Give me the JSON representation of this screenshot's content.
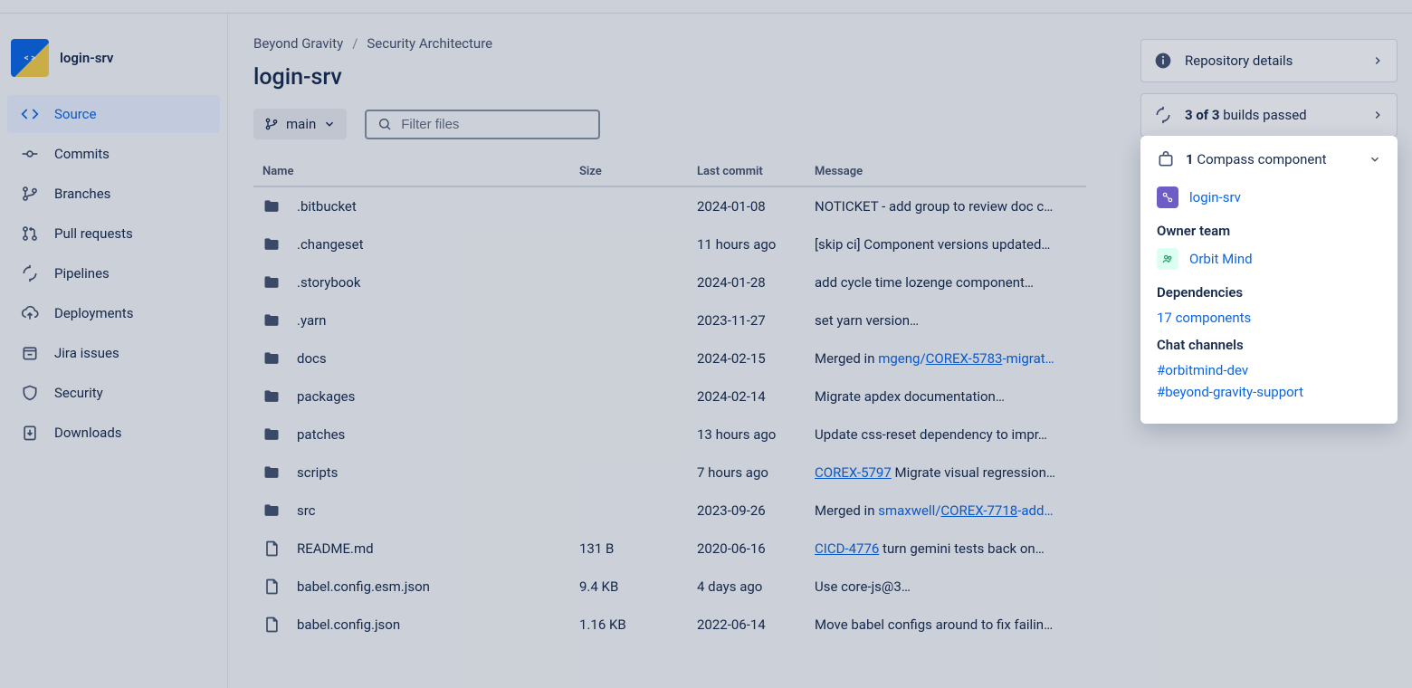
{
  "repo": {
    "name": "login-srv",
    "avatar_label": "<>"
  },
  "sidebar": {
    "items": [
      {
        "label": "Source",
        "icon": "code",
        "active": true
      },
      {
        "label": "Commits",
        "icon": "commit",
        "active": false
      },
      {
        "label": "Branches",
        "icon": "branch",
        "active": false
      },
      {
        "label": "Pull requests",
        "icon": "pr",
        "active": false
      },
      {
        "label": "Pipelines",
        "icon": "pipeline",
        "active": false
      },
      {
        "label": "Deployments",
        "icon": "deploy",
        "active": false
      },
      {
        "label": "Jira issues",
        "icon": "jira",
        "active": false
      },
      {
        "label": "Security",
        "icon": "shield",
        "active": false
      },
      {
        "label": "Downloads",
        "icon": "download",
        "active": false
      }
    ]
  },
  "breadcrumb": {
    "org": "Beyond Gravity",
    "project": "Security Architecture"
  },
  "page_title": "login-srv",
  "branch": {
    "label": "main"
  },
  "filter": {
    "placeholder": "Filter files"
  },
  "table": {
    "headers": {
      "name": "Name",
      "size": "Size",
      "last": "Last commit",
      "msg": "Message"
    },
    "rows": [
      {
        "type": "folder",
        "name": ".bitbucket",
        "size": "",
        "last": "2024-01-08",
        "msg": "NOTICKET - add group to review doc c…"
      },
      {
        "type": "folder",
        "name": ".changeset",
        "size": "",
        "last": "11 hours ago",
        "msg": "[skip ci] Component versions updated…"
      },
      {
        "type": "folder",
        "name": ".storybook",
        "size": "",
        "last": "2024-01-28",
        "msg": "add cycle time lozenge component…"
      },
      {
        "type": "folder",
        "name": ".yarn",
        "size": "",
        "last": "2023-11-27",
        "msg": "set yarn version…"
      },
      {
        "type": "folder",
        "name": "docs",
        "size": "",
        "last": "2024-02-15",
        "msg_pre": "Merged in ",
        "link1": "mgeng/",
        "link2": "COREX-5783",
        "msg_post": "-migrat…"
      },
      {
        "type": "folder",
        "name": "packages",
        "size": "",
        "last": "2024-02-14",
        "msg": "Migrate apdex documentation…"
      },
      {
        "type": "folder",
        "name": "patches",
        "size": "",
        "last": "13 hours ago",
        "msg": "Update css-reset dependency to impr…"
      },
      {
        "type": "folder",
        "name": "scripts",
        "size": "",
        "last": "7 hours ago",
        "link_u": "COREX-5797",
        "msg_post": " Migrate visual regression…"
      },
      {
        "type": "folder",
        "name": "src",
        "size": "",
        "last": "2023-09-26",
        "msg_pre": "Merged in ",
        "link1": "smaxwell/",
        "link2": "COREX-7718",
        "msg_post": "-add…"
      },
      {
        "type": "file",
        "name": "README.md",
        "size": "131 B",
        "last": "2020-06-16",
        "link_u": "CICD-4776",
        "msg_post": " turn gemini tests back on…"
      },
      {
        "type": "file",
        "name": "babel.config.esm.json",
        "size": "9.4 KB",
        "last": "4 days ago",
        "msg": "Use core-js@3…"
      },
      {
        "type": "file",
        "name": "babel.config.json",
        "size": "1.16 KB",
        "last": "2022-06-14",
        "msg": "Move babel configs around to fix failin…"
      }
    ]
  },
  "right": {
    "details_label": "Repository details",
    "builds_bold": "3 of 3",
    "builds_rest": " builds passed"
  },
  "compass": {
    "count": "1",
    "count_rest": " Compass component",
    "component_name": "login-srv",
    "owner_label": "Owner team",
    "owner_team": "Orbit Mind",
    "deps_label": "Dependencies",
    "deps_link": "17 components",
    "chat_label": "Chat channels",
    "chat1": "#orbitmind-dev",
    "chat2": "#beyond-gravity-support"
  }
}
